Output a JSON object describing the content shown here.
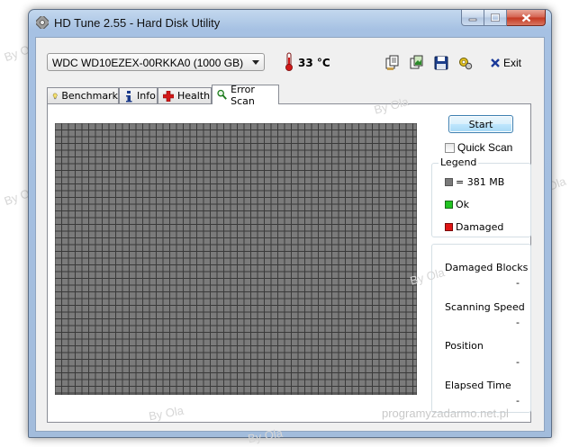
{
  "window": {
    "title": "HD Tune 2.55 - Hard Disk Utility"
  },
  "toolbar": {
    "drive": "WDC WD10EZEX-00RKKA0 (1000 GB)",
    "temperature": "33 °C",
    "exit_label": "Exit",
    "icons": [
      "copy-text-icon",
      "copy-screenshot-icon",
      "save-icon",
      "options-icon"
    ]
  },
  "tabs": [
    {
      "label": "Benchmark",
      "icon": "benchmark-icon"
    },
    {
      "label": "Info",
      "icon": "info-icon"
    },
    {
      "label": "Health",
      "icon": "health-icon"
    },
    {
      "label": "Error Scan",
      "icon": "error-scan-icon",
      "active": true
    }
  ],
  "scan": {
    "start_label": "Start",
    "quick_scan_label": "Quick Scan",
    "quick_scan_checked": false,
    "legend": {
      "caption": "Legend",
      "items": [
        {
          "label": "= 381 MB",
          "color": "#7a7a7a"
        },
        {
          "label": "Ok",
          "color": "#22c422"
        },
        {
          "label": "Damaged",
          "color": "#e01515"
        }
      ]
    },
    "stats": [
      {
        "label": "Damaged Blocks",
        "value": "-"
      },
      {
        "label": "Scanning Speed",
        "value": "-"
      },
      {
        "label": "Position",
        "value": "-"
      },
      {
        "label": "Elapsed Time",
        "value": "-"
      }
    ],
    "block_color": "#7b7b7b",
    "grid_line_color": "#3a3a3a"
  },
  "watermarks": [
    "By Ola",
    "By Ola",
    "By Ola",
    "By Ola",
    "By Ola",
    "By Ola",
    "By Ola",
    "By Ola",
    "programyzadarmo.net.pl"
  ]
}
